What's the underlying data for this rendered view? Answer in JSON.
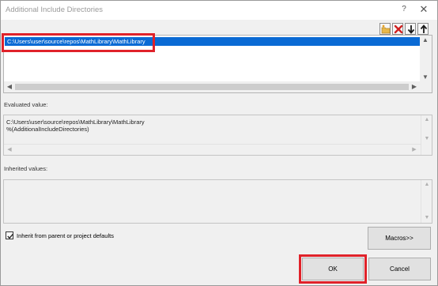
{
  "window": {
    "title": "Additional Include Directories",
    "help_label": "?",
    "close_label": "✕"
  },
  "toolbar": {
    "new_line_icon": "folder-new-icon",
    "delete_icon": "delete-x-icon",
    "move_down_icon": "arrow-down-icon",
    "move_up_icon": "arrow-up-icon"
  },
  "list": {
    "selected_entry": "C:\\Users\\user\\source\\repos\\MathLibrary\\MathLibrary"
  },
  "evaluated": {
    "label": "Evaluated value:",
    "lines": [
      "C:\\Users\\user\\source\\repos\\MathLibrary\\MathLibrary",
      "%(AdditionalIncludeDirectories)"
    ]
  },
  "inherited": {
    "label": "Inherited values:"
  },
  "inherit_checkbox": {
    "label": "Inherit from parent or project defaults",
    "checked": true
  },
  "buttons": {
    "macros": "Macros>>",
    "ok": "OK",
    "cancel": "Cancel"
  },
  "colors": {
    "highlight": "#e0222a",
    "selection": "#0a6ad4"
  }
}
